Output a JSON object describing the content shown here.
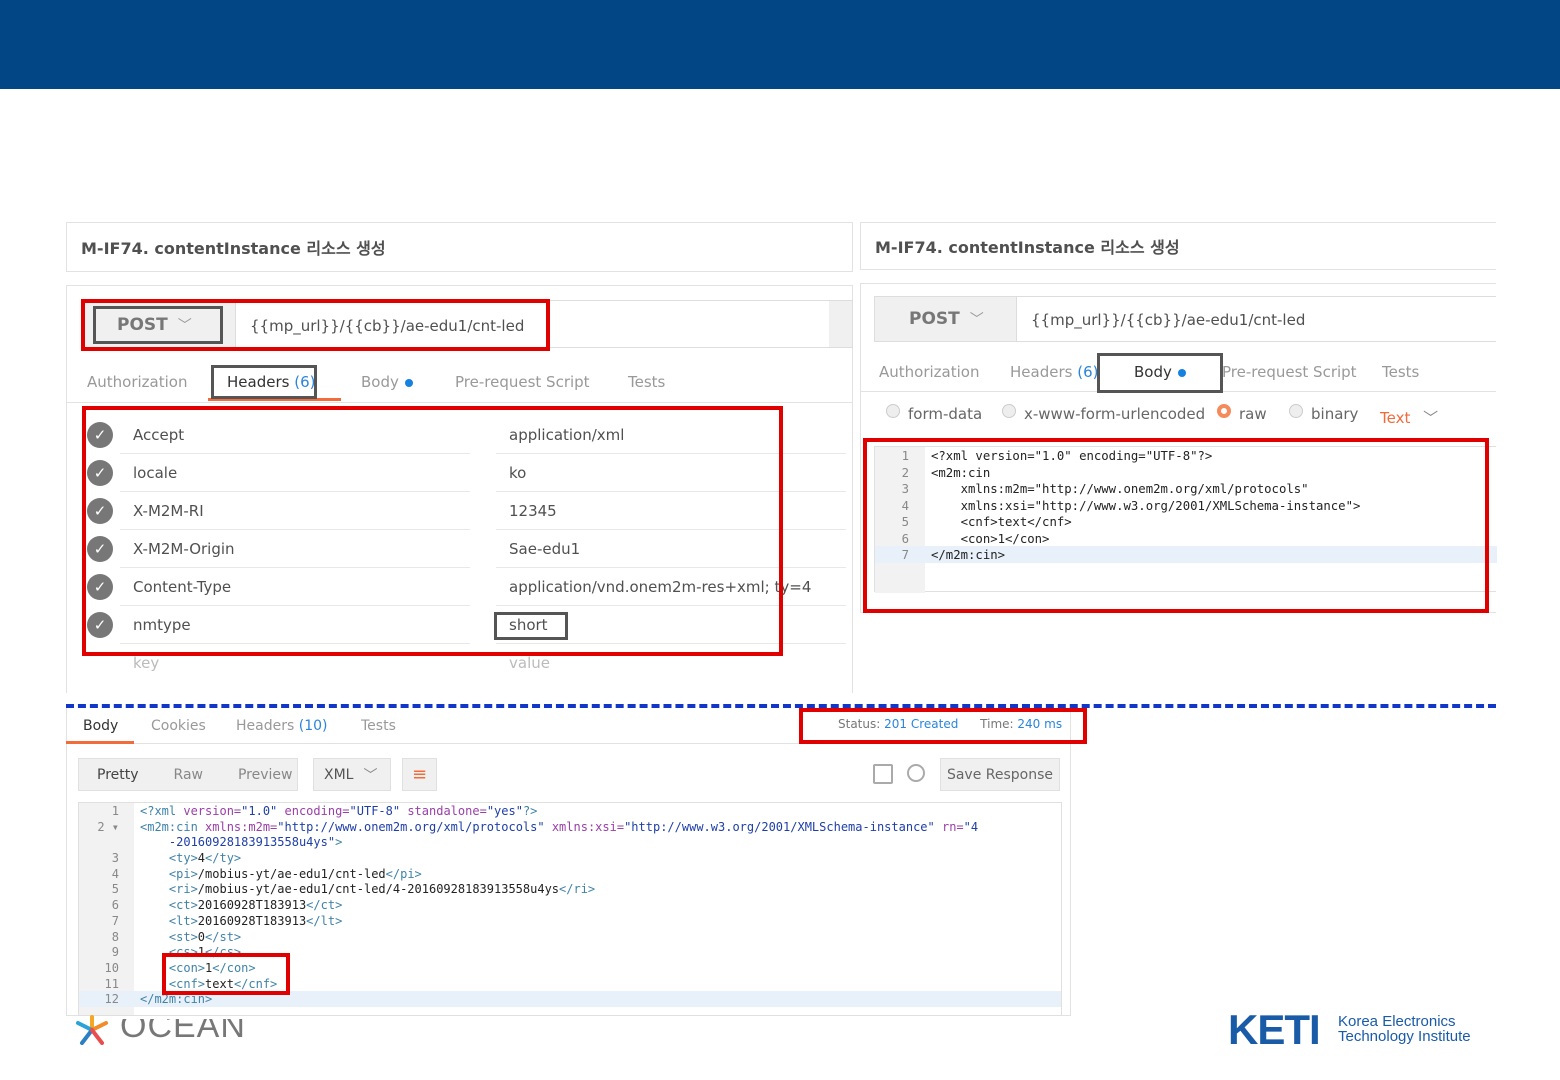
{
  "left_panel": {
    "title": "M-IF74. contentInstance 리소스 생성",
    "method": "POST",
    "url": "{{mp_url}}/{{cb}}/ae-edu1/cnt-led",
    "tabs": {
      "authorization": "Authorization",
      "headers": "Headers",
      "headers_count": "(6)",
      "body": "Body",
      "prerequest": "Pre-request Script",
      "tests": "Tests"
    },
    "headers": [
      {
        "key": "Accept",
        "value": "application/xml"
      },
      {
        "key": "locale",
        "value": "ko"
      },
      {
        "key": "X-M2M-RI",
        "value": "12345"
      },
      {
        "key": "X-M2M-Origin",
        "value": "Sae-edu1"
      },
      {
        "key": "Content-Type",
        "value": "application/vnd.onem2m-res+xml; ty=4"
      },
      {
        "key": "nmtype",
        "value": "short"
      }
    ],
    "key_placeholder": "key",
    "value_placeholder": "value"
  },
  "right_panel": {
    "title": "M-IF74. contentInstance 리소스 생성",
    "method": "POST",
    "url": "{{mp_url}}/{{cb}}/ae-edu1/cnt-led",
    "tabs": {
      "authorization": "Authorization",
      "headers": "Headers",
      "headers_count": "(6)",
      "body": "Body",
      "prerequest": "Pre-request Script",
      "tests": "Tests"
    },
    "body_modes": {
      "form_data": "form-data",
      "urlencoded": "x-www-form-urlencoded",
      "raw": "raw",
      "binary": "binary",
      "selected": "raw"
    },
    "format": "Text",
    "code_lines": [
      {
        "n": "1",
        "text": "<?xml version=\"1.0\" encoding=\"UTF-8\"?>"
      },
      {
        "n": "2",
        "text": "<m2m:cin"
      },
      {
        "n": "3",
        "text": "    xmlns:m2m=\"http://www.onem2m.org/xml/protocols\""
      },
      {
        "n": "4",
        "text": "    xmlns:xsi=\"http://www.w3.org/2001/XMLSchema-instance\">"
      },
      {
        "n": "5",
        "text": "    <cnf>text</cnf>"
      },
      {
        "n": "6",
        "text": "    <con>1</con>"
      },
      {
        "n": "7",
        "text": "</m2m:cin>"
      }
    ]
  },
  "response": {
    "tabs": {
      "body": "Body",
      "cookies": "Cookies",
      "headers": "Headers",
      "headers_count": "(10)",
      "tests": "Tests"
    },
    "status_label": "Status:",
    "status_value": "201 Created",
    "time_label": "Time:",
    "time_value": "240 ms",
    "view_modes": {
      "pretty": "Pretty",
      "raw": "Raw",
      "preview": "Preview"
    },
    "format": "XML",
    "save_response": "Save Response",
    "code_lines": [
      {
        "n": "1",
        "parts": [
          [
            "tag",
            "<?xml "
          ],
          [
            "attr",
            "version="
          ],
          [
            "str",
            "\"1.0\""
          ],
          [
            "attr",
            " encoding="
          ],
          [
            "str",
            "\"UTF-8\""
          ],
          [
            "attr",
            " standalone="
          ],
          [
            "str",
            "\"yes\""
          ],
          [
            "tag",
            "?>"
          ]
        ]
      },
      {
        "n": "2 ▾",
        "parts": [
          [
            "tag",
            "<m2m:cin "
          ],
          [
            "attr",
            "xmlns:m2m="
          ],
          [
            "str",
            "\"http://www.onem2m.org/xml/protocols\""
          ],
          [
            "attr",
            " xmlns:xsi="
          ],
          [
            "str",
            "\"http://www.w3.org/2001/XMLSchema-instance\""
          ],
          [
            "attr",
            " rn="
          ],
          [
            "str",
            "\"4"
          ]
        ]
      },
      {
        "n": "",
        "parts": [
          [
            "str",
            "    -20160928183913558u4ys\""
          ],
          [
            "tag",
            ">"
          ]
        ]
      },
      {
        "n": "3",
        "parts": [
          [
            "tag",
            "    <ty>"
          ],
          [
            "txt",
            "4"
          ],
          [
            "tag",
            "</ty>"
          ]
        ]
      },
      {
        "n": "4",
        "parts": [
          [
            "tag",
            "    <pi>"
          ],
          [
            "txt",
            "/mobius-yt/ae-edu1/cnt-led"
          ],
          [
            "tag",
            "</pi>"
          ]
        ]
      },
      {
        "n": "5",
        "parts": [
          [
            "tag",
            "    <ri>"
          ],
          [
            "txt",
            "/mobius-yt/ae-edu1/cnt-led/4-20160928183913558u4ys"
          ],
          [
            "tag",
            "</ri>"
          ]
        ]
      },
      {
        "n": "6",
        "parts": [
          [
            "tag",
            "    <ct>"
          ],
          [
            "txt",
            "20160928T183913"
          ],
          [
            "tag",
            "</ct>"
          ]
        ]
      },
      {
        "n": "7",
        "parts": [
          [
            "tag",
            "    <lt>"
          ],
          [
            "txt",
            "20160928T183913"
          ],
          [
            "tag",
            "</lt>"
          ]
        ]
      },
      {
        "n": "8",
        "parts": [
          [
            "tag",
            "    <st>"
          ],
          [
            "txt",
            "0"
          ],
          [
            "tag",
            "</st>"
          ]
        ]
      },
      {
        "n": "9",
        "parts": [
          [
            "tag",
            "    <cs>"
          ],
          [
            "txt",
            "1"
          ],
          [
            "tag",
            "</cs>"
          ]
        ]
      },
      {
        "n": "10",
        "parts": [
          [
            "tag",
            "    <con>"
          ],
          [
            "txt",
            "1"
          ],
          [
            "tag",
            "</con>"
          ]
        ]
      },
      {
        "n": "11",
        "parts": [
          [
            "tag",
            "    <cnf>"
          ],
          [
            "txt",
            "text"
          ],
          [
            "tag",
            "</cnf>"
          ]
        ]
      },
      {
        "n": "12",
        "parts": [
          [
            "tag",
            "</m2m:cin>"
          ]
        ]
      }
    ]
  },
  "footer": {
    "ocean_logo": "OCEAN",
    "keti_logo": "KETI",
    "keti_line1": "Korea Electronics",
    "keti_line2": "Technology Institute"
  },
  "colors": {
    "header_bar": "#034685",
    "highlight": "#e00000",
    "accent": "#f26b3a",
    "link": "#2a85dc",
    "separator": "#1237c8"
  }
}
